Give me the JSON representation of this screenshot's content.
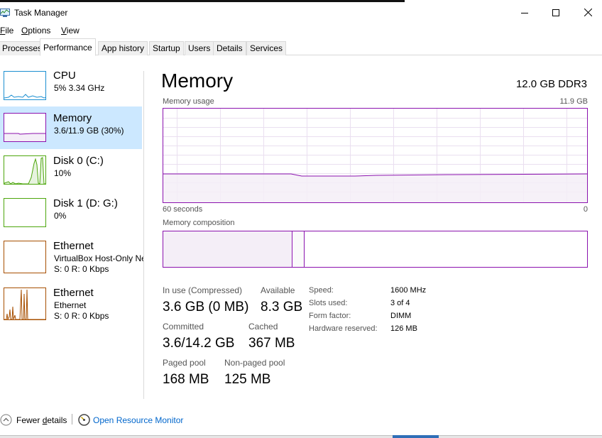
{
  "window": {
    "title": "Task Manager",
    "minimize_icon": "minimize-icon",
    "maximize_icon": "maximize-icon",
    "close_icon": "close-icon"
  },
  "menu": {
    "file": {
      "accel": "F",
      "rest": "ile"
    },
    "options": {
      "accel": "O",
      "rest": "ptions"
    },
    "view": {
      "accel": "V",
      "rest": "iew"
    }
  },
  "tabs": [
    "Processes",
    "Performance",
    "App history",
    "Startup",
    "Users",
    "Details",
    "Services"
  ],
  "active_tab": "Performance",
  "sidebar": [
    {
      "title": "CPU",
      "sub1": "5%  3.34 GHz",
      "sub2": "",
      "color": "#1c8fd1"
    },
    {
      "title": "Memory",
      "sub1": "3.6/11.9 GB (30%)",
      "sub2": "",
      "color": "#8b12ae"
    },
    {
      "title": "Disk 0 (C:)",
      "sub1": "10%",
      "sub2": "",
      "color": "#4da60c"
    },
    {
      "title": "Disk 1 (D: G:)",
      "sub1": "0%",
      "sub2": "",
      "color": "#4da60c"
    },
    {
      "title": "Ethernet",
      "sub1": "VirtualBox Host-Only Ne",
      "sub2": "S: 0  R: 0 Kbps",
      "color": "#a74f01"
    },
    {
      "title": "Ethernet",
      "sub1": "Ethernet",
      "sub2": "S: 0  R: 0 Kbps",
      "color": "#a74f01"
    }
  ],
  "main": {
    "title": "Memory",
    "spec": "12.0 GB DDR3",
    "usage_label": "Memory usage",
    "usage_max": "11.9 GB",
    "time_left": "60 seconds",
    "time_right": "0",
    "composition_label": "Memory composition",
    "accent_color": "#8b12ae",
    "usage_fraction": 0.3
  },
  "stats": {
    "in_use_label": "In use (Compressed)",
    "in_use_value": "3.6 GB (0 MB)",
    "available_label": "Available",
    "available_value": "8.3 GB",
    "committed_label": "Committed",
    "committed_value": "3.6/14.2 GB",
    "cached_label": "Cached",
    "cached_value": "367 MB",
    "paged_label": "Paged pool",
    "paged_value": "168 MB",
    "nonpaged_label": "Non-paged pool",
    "nonpaged_value": "125 MB"
  },
  "details": [
    {
      "label": "Speed:",
      "value": "1600 MHz"
    },
    {
      "label": "Slots used:",
      "value": "3 of 4"
    },
    {
      "label": "Form factor:",
      "value": "DIMM"
    },
    {
      "label": "Hardware reserved:",
      "value": "126 MB"
    }
  ],
  "footer": {
    "fewer_details": {
      "accel_prefix": "Fewer ",
      "accel": "d",
      "rest": "etails"
    },
    "open_monitor": "Open Resource Monitor",
    "link_color": "#0066cc"
  }
}
